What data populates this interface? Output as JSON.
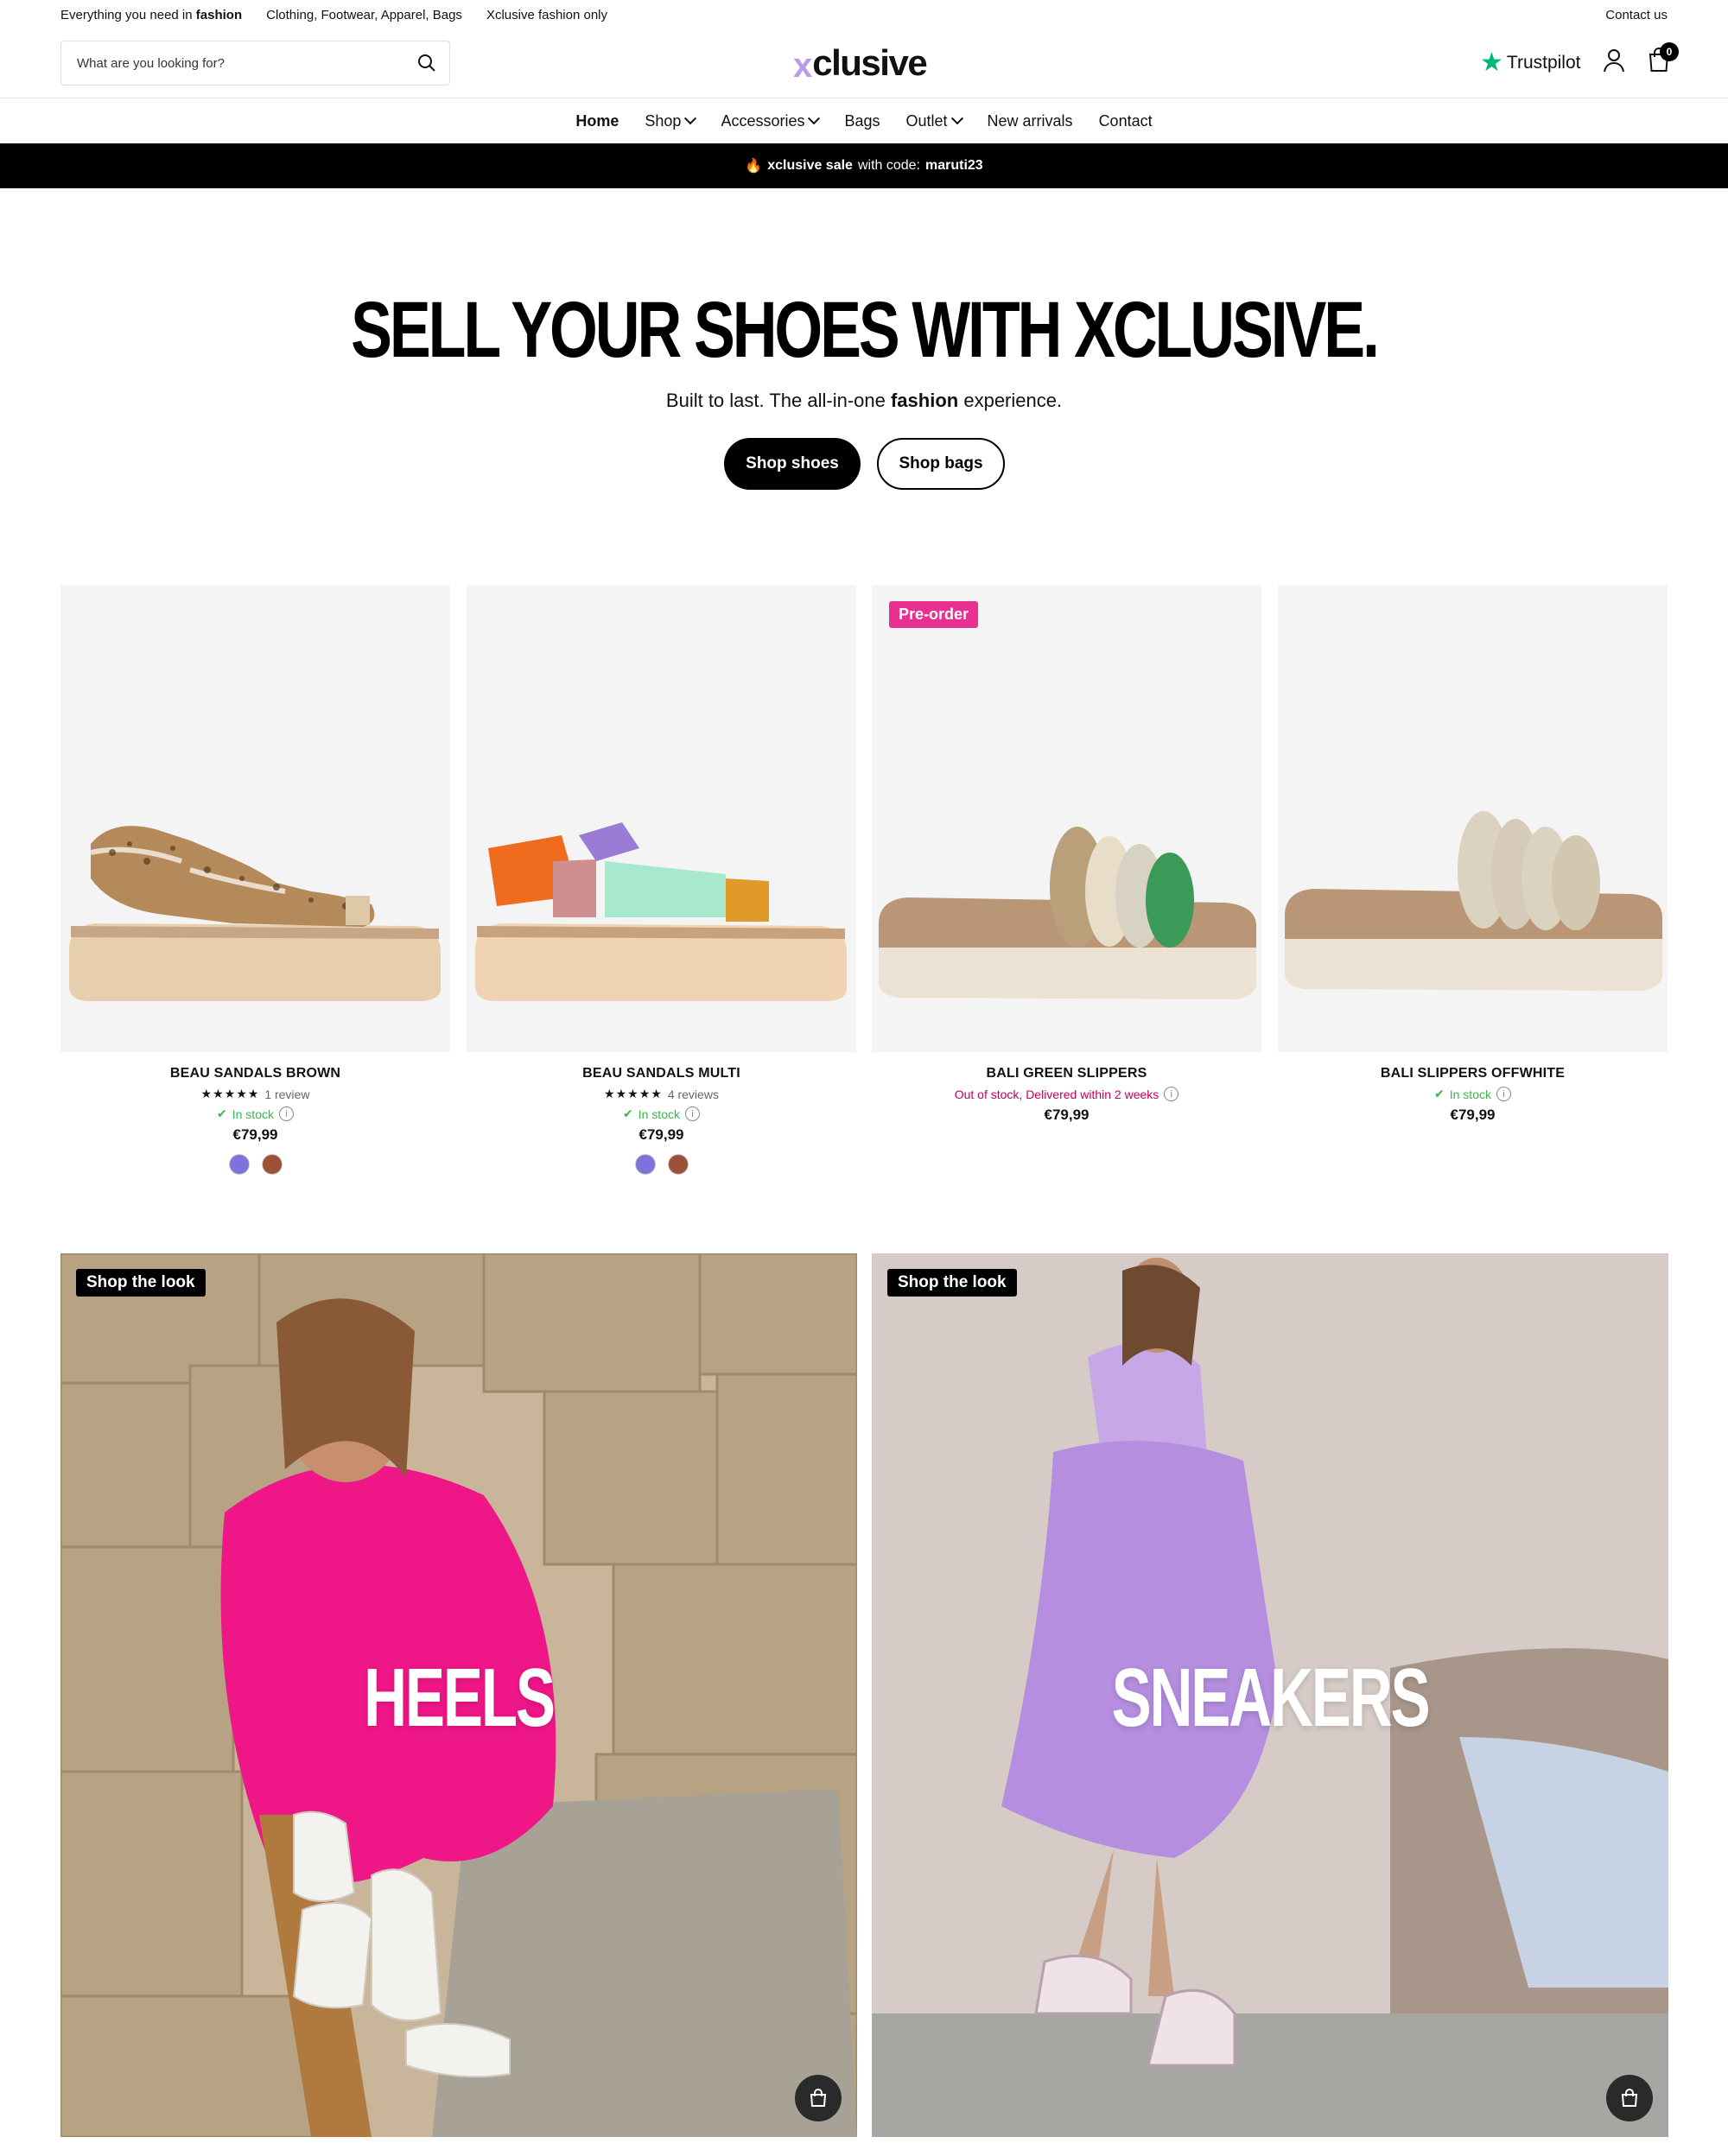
{
  "topbar": {
    "left_prefix": "Everything you need in",
    "left_bold": "fashion",
    "categories": "Clothing, Footwear, Apparel, Bags",
    "exclusive": "Xclusive fashion only",
    "contact": "Contact us"
  },
  "header": {
    "search_placeholder": "What are you looking for?",
    "logo_mark": "x",
    "logo_word": "clusive",
    "trustpilot": "Trustpilot",
    "cart_count": "0"
  },
  "nav": {
    "items": [
      "Home",
      "Shop",
      "Accessories",
      "Bags",
      "Outlet",
      "New arrivals",
      "Contact"
    ]
  },
  "promo": {
    "bold": "xclusive sale",
    "text": "with code:",
    "code": "maruti23"
  },
  "hero": {
    "title": "SELL YOUR SHOES WITH XCLUSIVE.",
    "sub_prefix": "Built to last. The all-in-one",
    "sub_bold": "fashion",
    "sub_suffix": "experience.",
    "btn_primary": "Shop shoes",
    "btn_secondary": "Shop bags"
  },
  "products": [
    {
      "name": "BEAU SANDALS BROWN",
      "stars": "★★★★★",
      "reviews": "1 review",
      "stock": "In stock",
      "price": "€79,99",
      "swatches": [
        "#7b73d9",
        "#9c5038"
      ]
    },
    {
      "name": "BEAU SANDALS MULTI",
      "stars": "★★★★★",
      "reviews": "4 reviews",
      "stock": "In stock",
      "price": "€79,99",
      "swatches": [
        "#7b73d9",
        "#9c5038"
      ]
    },
    {
      "name": "BALI GREEN SLIPPERS",
      "badge": "Pre-order",
      "stock": "Out of stock, Delivered within 2 weeks",
      "price": "€79,99"
    },
    {
      "name": "BALI SLIPPERS OFFWHITE",
      "stock": "In stock",
      "price": "€79,99"
    }
  ],
  "looks": [
    {
      "tag": "Shop the look",
      "title": "HEELS"
    },
    {
      "tag": "Shop the look",
      "title": "SNEAKERS"
    }
  ],
  "colors": {
    "accent_pink": "#e9308e",
    "logo_purple": "#b79be8",
    "trustpilot_green": "#00b67a",
    "in_stock_green": "#3cb54a"
  }
}
